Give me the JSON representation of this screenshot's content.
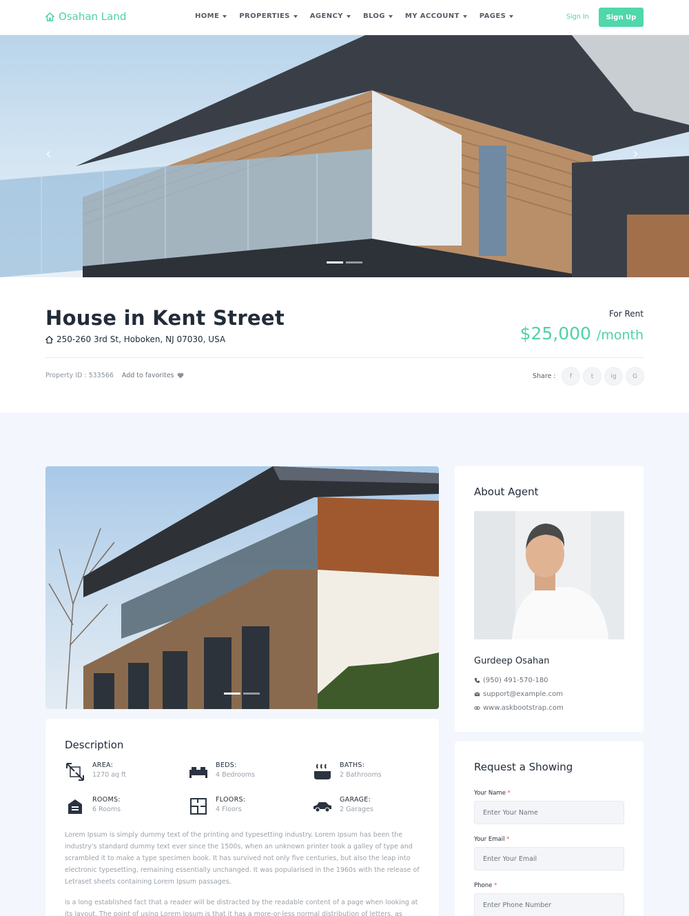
{
  "brand": {
    "name": "Osahan Land"
  },
  "nav": {
    "items": [
      {
        "label": "HOME"
      },
      {
        "label": "PROPERTIES"
      },
      {
        "label": "AGENCY"
      },
      {
        "label": "BLOG"
      },
      {
        "label": "MY ACCOUNT"
      },
      {
        "label": "PAGES"
      }
    ],
    "signin": "Sign In",
    "signup": "Sign Up"
  },
  "hero": {
    "slides": 2,
    "active_slide": 1
  },
  "property": {
    "title": "House in Kent Street",
    "address": "250-260 3rd St, Hoboken, NJ 07030, USA",
    "status": "For Rent",
    "price": "$25,000",
    "price_period": "/month",
    "id_label": "Property ID :",
    "id_value": "533566",
    "favorite": "Add to favorites",
    "share_label": "Share :",
    "socials": [
      "f",
      "t",
      "ig",
      "G"
    ]
  },
  "description": {
    "title": "Description",
    "features": [
      {
        "icon": "area-icon",
        "label": "AREA:",
        "value": "1270 aq ft"
      },
      {
        "icon": "bed-icon",
        "label": "BEDS:",
        "value": "4 Bedrooms"
      },
      {
        "icon": "bath-icon",
        "label": "BATHS:",
        "value": "2 Bathrooms"
      },
      {
        "icon": "rooms-icon",
        "label": "ROOMS:",
        "value": "6 Rooms"
      },
      {
        "icon": "floors-icon",
        "label": "FLOORS:",
        "value": "4 Floors"
      },
      {
        "icon": "garage-icon",
        "label": "GARAGE:",
        "value": "2 Garages"
      }
    ],
    "paragraph1": "Lorem Ipsum is simply dummy text of the printing and typesetting industry. Lorem Ipsum has been the industry's standard dummy text ever since the 1500s, when an unknown printer took a galley of type and scrambled it to make a type specimen book. It has survived not only five centuries, but also the leap into electronic typesetting, remaining essentially unchanged. It was popularised in the 1960s with the release of Letraset sheets containing Lorem Ipsum passages,",
    "paragraph2": "is a long established fact that a reader will be distracted by the readable content of a page when looking at its layout. The point of using Lorem Ipsum is that it has a more-or-less normal distribution of letters, as opposed"
  },
  "agent": {
    "title": "About Agent",
    "name": "Gurdeep Osahan",
    "phone": "(950) 491-570-180",
    "email": "support@example.com",
    "website": "www.askbootstrap.com"
  },
  "request": {
    "title": "Request a Showing",
    "fields": [
      {
        "label": "Your Name",
        "placeholder": "Enter Your Name"
      },
      {
        "label": "Your Email",
        "placeholder": "Enter Your Email"
      },
      {
        "label": "Phone",
        "placeholder": "Enter Phone Number"
      }
    ]
  },
  "colors": {
    "accent": "#50d7ac",
    "heading": "#222c39",
    "muted": "#9aa1aa",
    "section_bg": "#f3f7fd"
  }
}
